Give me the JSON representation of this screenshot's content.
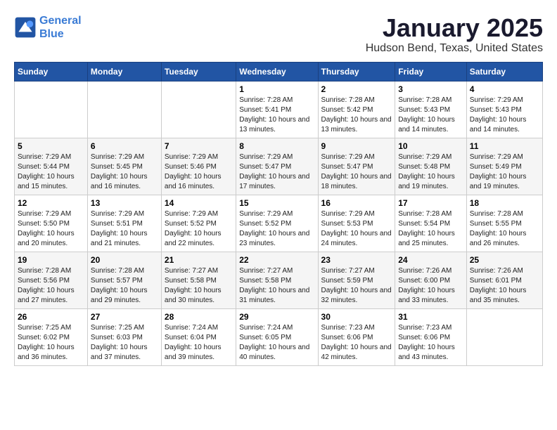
{
  "logo": {
    "line1": "General",
    "line2": "Blue"
  },
  "title": "January 2025",
  "subtitle": "Hudson Bend, Texas, United States",
  "days_of_week": [
    "Sunday",
    "Monday",
    "Tuesday",
    "Wednesday",
    "Thursday",
    "Friday",
    "Saturday"
  ],
  "weeks": [
    [
      {
        "num": "",
        "sunrise": "",
        "sunset": "",
        "daylight": "",
        "empty": true
      },
      {
        "num": "",
        "sunrise": "",
        "sunset": "",
        "daylight": "",
        "empty": true
      },
      {
        "num": "",
        "sunrise": "",
        "sunset": "",
        "daylight": "",
        "empty": true
      },
      {
        "num": "1",
        "sunrise": "Sunrise: 7:28 AM",
        "sunset": "Sunset: 5:41 PM",
        "daylight": "Daylight: 10 hours and 13 minutes.",
        "empty": false
      },
      {
        "num": "2",
        "sunrise": "Sunrise: 7:28 AM",
        "sunset": "Sunset: 5:42 PM",
        "daylight": "Daylight: 10 hours and 13 minutes.",
        "empty": false
      },
      {
        "num": "3",
        "sunrise": "Sunrise: 7:28 AM",
        "sunset": "Sunset: 5:43 PM",
        "daylight": "Daylight: 10 hours and 14 minutes.",
        "empty": false
      },
      {
        "num": "4",
        "sunrise": "Sunrise: 7:29 AM",
        "sunset": "Sunset: 5:43 PM",
        "daylight": "Daylight: 10 hours and 14 minutes.",
        "empty": false
      }
    ],
    [
      {
        "num": "5",
        "sunrise": "Sunrise: 7:29 AM",
        "sunset": "Sunset: 5:44 PM",
        "daylight": "Daylight: 10 hours and 15 minutes.",
        "empty": false
      },
      {
        "num": "6",
        "sunrise": "Sunrise: 7:29 AM",
        "sunset": "Sunset: 5:45 PM",
        "daylight": "Daylight: 10 hours and 16 minutes.",
        "empty": false
      },
      {
        "num": "7",
        "sunrise": "Sunrise: 7:29 AM",
        "sunset": "Sunset: 5:46 PM",
        "daylight": "Daylight: 10 hours and 16 minutes.",
        "empty": false
      },
      {
        "num": "8",
        "sunrise": "Sunrise: 7:29 AM",
        "sunset": "Sunset: 5:47 PM",
        "daylight": "Daylight: 10 hours and 17 minutes.",
        "empty": false
      },
      {
        "num": "9",
        "sunrise": "Sunrise: 7:29 AM",
        "sunset": "Sunset: 5:47 PM",
        "daylight": "Daylight: 10 hours and 18 minutes.",
        "empty": false
      },
      {
        "num": "10",
        "sunrise": "Sunrise: 7:29 AM",
        "sunset": "Sunset: 5:48 PM",
        "daylight": "Daylight: 10 hours and 19 minutes.",
        "empty": false
      },
      {
        "num": "11",
        "sunrise": "Sunrise: 7:29 AM",
        "sunset": "Sunset: 5:49 PM",
        "daylight": "Daylight: 10 hours and 19 minutes.",
        "empty": false
      }
    ],
    [
      {
        "num": "12",
        "sunrise": "Sunrise: 7:29 AM",
        "sunset": "Sunset: 5:50 PM",
        "daylight": "Daylight: 10 hours and 20 minutes.",
        "empty": false
      },
      {
        "num": "13",
        "sunrise": "Sunrise: 7:29 AM",
        "sunset": "Sunset: 5:51 PM",
        "daylight": "Daylight: 10 hours and 21 minutes.",
        "empty": false
      },
      {
        "num": "14",
        "sunrise": "Sunrise: 7:29 AM",
        "sunset": "Sunset: 5:52 PM",
        "daylight": "Daylight: 10 hours and 22 minutes.",
        "empty": false
      },
      {
        "num": "15",
        "sunrise": "Sunrise: 7:29 AM",
        "sunset": "Sunset: 5:52 PM",
        "daylight": "Daylight: 10 hours and 23 minutes.",
        "empty": false
      },
      {
        "num": "16",
        "sunrise": "Sunrise: 7:29 AM",
        "sunset": "Sunset: 5:53 PM",
        "daylight": "Daylight: 10 hours and 24 minutes.",
        "empty": false
      },
      {
        "num": "17",
        "sunrise": "Sunrise: 7:28 AM",
        "sunset": "Sunset: 5:54 PM",
        "daylight": "Daylight: 10 hours and 25 minutes.",
        "empty": false
      },
      {
        "num": "18",
        "sunrise": "Sunrise: 7:28 AM",
        "sunset": "Sunset: 5:55 PM",
        "daylight": "Daylight: 10 hours and 26 minutes.",
        "empty": false
      }
    ],
    [
      {
        "num": "19",
        "sunrise": "Sunrise: 7:28 AM",
        "sunset": "Sunset: 5:56 PM",
        "daylight": "Daylight: 10 hours and 27 minutes.",
        "empty": false
      },
      {
        "num": "20",
        "sunrise": "Sunrise: 7:28 AM",
        "sunset": "Sunset: 5:57 PM",
        "daylight": "Daylight: 10 hours and 29 minutes.",
        "empty": false
      },
      {
        "num": "21",
        "sunrise": "Sunrise: 7:27 AM",
        "sunset": "Sunset: 5:58 PM",
        "daylight": "Daylight: 10 hours and 30 minutes.",
        "empty": false
      },
      {
        "num": "22",
        "sunrise": "Sunrise: 7:27 AM",
        "sunset": "Sunset: 5:58 PM",
        "daylight": "Daylight: 10 hours and 31 minutes.",
        "empty": false
      },
      {
        "num": "23",
        "sunrise": "Sunrise: 7:27 AM",
        "sunset": "Sunset: 5:59 PM",
        "daylight": "Daylight: 10 hours and 32 minutes.",
        "empty": false
      },
      {
        "num": "24",
        "sunrise": "Sunrise: 7:26 AM",
        "sunset": "Sunset: 6:00 PM",
        "daylight": "Daylight: 10 hours and 33 minutes.",
        "empty": false
      },
      {
        "num": "25",
        "sunrise": "Sunrise: 7:26 AM",
        "sunset": "Sunset: 6:01 PM",
        "daylight": "Daylight: 10 hours and 35 minutes.",
        "empty": false
      }
    ],
    [
      {
        "num": "26",
        "sunrise": "Sunrise: 7:25 AM",
        "sunset": "Sunset: 6:02 PM",
        "daylight": "Daylight: 10 hours and 36 minutes.",
        "empty": false
      },
      {
        "num": "27",
        "sunrise": "Sunrise: 7:25 AM",
        "sunset": "Sunset: 6:03 PM",
        "daylight": "Daylight: 10 hours and 37 minutes.",
        "empty": false
      },
      {
        "num": "28",
        "sunrise": "Sunrise: 7:24 AM",
        "sunset": "Sunset: 6:04 PM",
        "daylight": "Daylight: 10 hours and 39 minutes.",
        "empty": false
      },
      {
        "num": "29",
        "sunrise": "Sunrise: 7:24 AM",
        "sunset": "Sunset: 6:05 PM",
        "daylight": "Daylight: 10 hours and 40 minutes.",
        "empty": false
      },
      {
        "num": "30",
        "sunrise": "Sunrise: 7:23 AM",
        "sunset": "Sunset: 6:06 PM",
        "daylight": "Daylight: 10 hours and 42 minutes.",
        "empty": false
      },
      {
        "num": "31",
        "sunrise": "Sunrise: 7:23 AM",
        "sunset": "Sunset: 6:06 PM",
        "daylight": "Daylight: 10 hours and 43 minutes.",
        "empty": false
      },
      {
        "num": "",
        "sunrise": "",
        "sunset": "",
        "daylight": "",
        "empty": true
      }
    ]
  ]
}
